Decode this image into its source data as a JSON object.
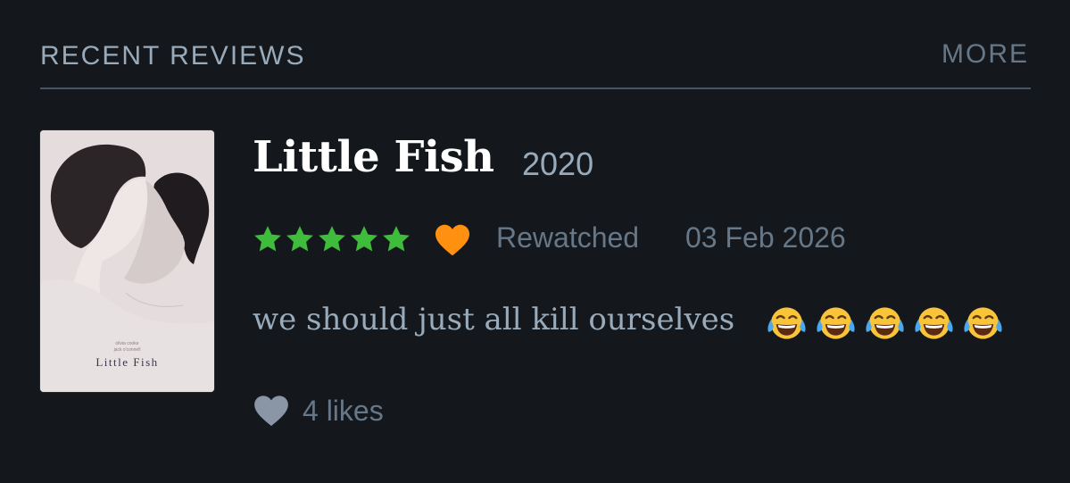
{
  "section": {
    "title": "RECENT REVIEWS",
    "more_label": "MORE"
  },
  "review": {
    "film_title": "Little Fish",
    "year": "2020",
    "rating": {
      "value": 5,
      "max": 5
    },
    "liked": true,
    "rewatch_label": "Rewatched",
    "date": "03 Feb 2026",
    "text": "we should just all kill ourselves",
    "emoji": "face-with-tears-of-joy-icon",
    "emoji_count": 5,
    "likes_label": "4 likes"
  },
  "poster": {
    "title": "Little Fish",
    "credits_line1": "olivia cooke",
    "credits_line2": "jack o'connell"
  },
  "colors": {
    "background": "#14181c",
    "star_green": "#40bc3c",
    "liked_orange": "#ff9010",
    "muted_text": "#678",
    "secondary_text": "#9ab",
    "title_white": "#ffffff"
  }
}
